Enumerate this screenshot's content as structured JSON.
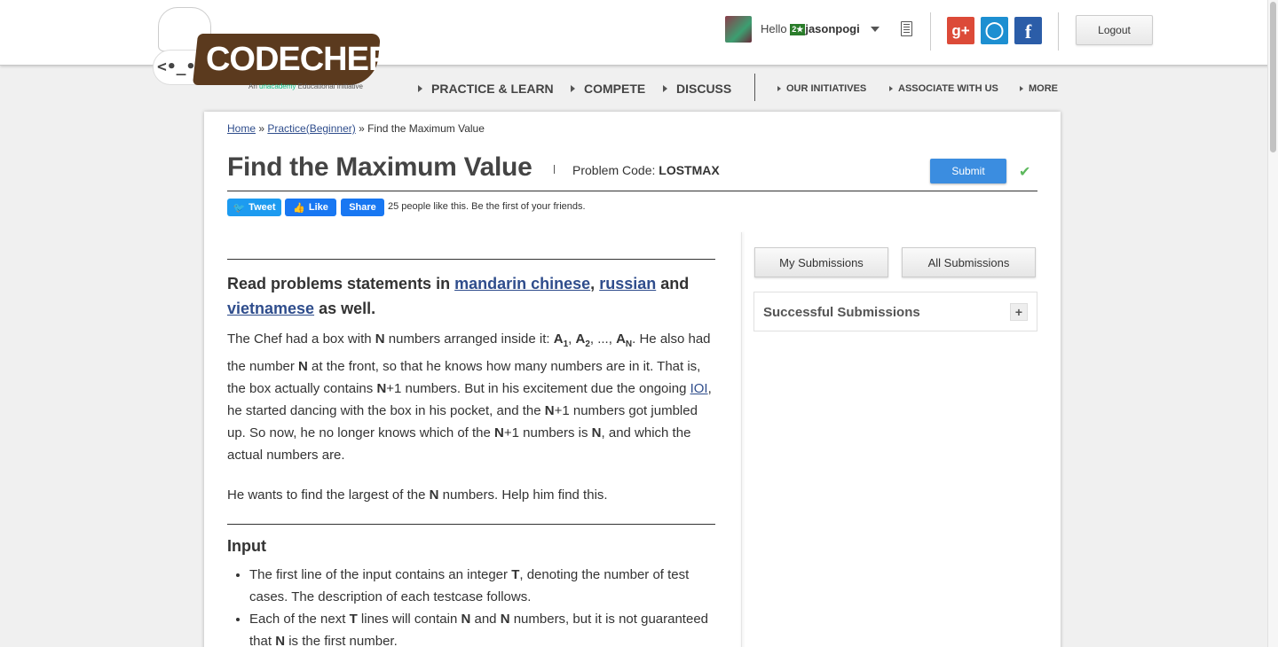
{
  "logo": {
    "wordmark": "CODECHEF",
    "mascot_face": "<•_•>",
    "tagline_prefix": "An",
    "tagline_brand": "unacademy",
    "tagline_suffix": "Educational Initiative"
  },
  "user": {
    "greeting": "Hello",
    "stars": "2★",
    "username": "jasonpogi"
  },
  "header": {
    "google_label": "g+",
    "github_label": "◯",
    "facebook_label": "f",
    "logout_label": "Logout"
  },
  "nav": {
    "main": [
      "PRACTICE & LEARN",
      "COMPETE",
      "DISCUSS"
    ],
    "secondary": [
      "OUR INITIATIVES",
      "ASSOCIATE WITH US",
      "MORE"
    ]
  },
  "breadcrumb": {
    "home": "Home",
    "sep1": " » ",
    "practice": "Practice(Beginner)",
    "sep2": " » ",
    "current": "Find the Maximum Value"
  },
  "problem": {
    "title": "Find the Maximum Value",
    "code_label": "Problem Code:",
    "code": "LOSTMAX",
    "submit_label": "Submit",
    "status_check": "✔"
  },
  "social_share": {
    "tweet": "Tweet",
    "like": "Like",
    "share": "Share",
    "like_text": "25 people like this. Be the first of your friends."
  },
  "statement": {
    "lang_prefix": "Read problems statements in",
    "lang1": "mandarin chinese",
    "lang_sep": ",",
    "lang2": "russian",
    "lang_and": "and",
    "lang3": "vietnamese",
    "lang_suffix": "as well.",
    "p1_a": "The Chef had a box with ",
    "N": "N",
    "p1_b": " numbers arranged inside it: ",
    "A": "A",
    "s1": "1",
    "s2": "2",
    "sN": "N",
    "comma": ", ",
    "ellipsis": ", ..., ",
    "p1_c": ". He also had the number ",
    "p1_d": " at the front, so that he knows how many numbers are in it. That is, the box actually contains ",
    "p1_e": "+1 numbers. But in his excitement due the ongoing ",
    "ioi": "IOI",
    "p1_f": ", he started dancing with the box in his pocket, and the ",
    "p1_g": "+1 numbers got jumbled up. So now, he no longer knows which of the ",
    "p1_h": "+1 numbers is ",
    "p1_i": ", and which the actual numbers are.",
    "p2_a": "He wants to find the largest of the ",
    "p2_b": " numbers. Help him find this."
  },
  "input_section": {
    "heading": "Input",
    "b1_a": "The first line of the input contains an integer ",
    "T": "T",
    "b1_b": ", denoting the number of test cases. The description of each testcase follows.",
    "b2_a": "Each of the next ",
    "b2_b": " lines will contain ",
    "b2_c": " and ",
    "b2_d": " numbers, but it is not guaranteed that ",
    "b2_e": " is the first number."
  },
  "sidebar": {
    "my_submissions": "My Submissions",
    "all_submissions": "All Submissions",
    "successful_submissions": "Successful Submissions",
    "expand": "+"
  }
}
